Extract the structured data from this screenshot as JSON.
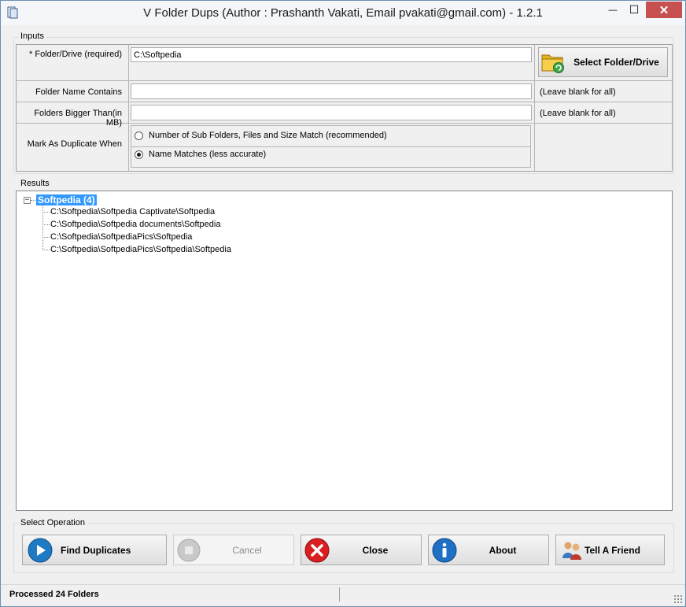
{
  "window": {
    "title": "V Folder Dups (Author : Prashanth Vakati, Email pvakati@gmail.com) - 1.2.1",
    "minimize_glyph": "—",
    "maximize_glyph": "☐",
    "close_glyph": "✕"
  },
  "inputs": {
    "group_label": "Inputs",
    "folder_label": "* Folder/Drive (required)",
    "folder_value": "C:\\Softpedia",
    "select_button": "Select Folder/Drive",
    "name_contains_label": "Folder Name Contains",
    "name_contains_value": "",
    "name_contains_hint": "(Leave blank for all)",
    "bigger_than_label": "Folders Bigger Than(in MB)",
    "bigger_than_value": "",
    "bigger_than_hint": "(Leave blank for all)",
    "mark_label": "Mark As Duplicate When",
    "option_1": "Number of Sub Folders, Files and Size Match (recommended)",
    "option_2": "Name Matches (less accurate)",
    "selected_option": 2
  },
  "results": {
    "group_label": "Results",
    "root": "Softpedia (4)",
    "items": [
      "C:\\Softpedia\\Softpedia Captivate\\Softpedia",
      "C:\\Softpedia\\Softpedia documents\\Softpedia",
      "C:\\Softpedia\\SoftpediaPics\\Softpedia",
      "C:\\Softpedia\\SoftpediaPics\\Softpedia\\Softpedia"
    ]
  },
  "operations": {
    "group_label": "Select Operation",
    "find": "Find Duplicates",
    "cancel": "Cancel",
    "close": "Close",
    "about": "About",
    "tell": "Tell A Friend"
  },
  "status": {
    "text": "Processed 24 Folders"
  },
  "colors": {
    "selection": "#3399ff",
    "close_button": "#c75050",
    "play_icon": "#1f7ac4",
    "close_icon": "#d81e1e",
    "info_icon": "#1f6fc4"
  }
}
